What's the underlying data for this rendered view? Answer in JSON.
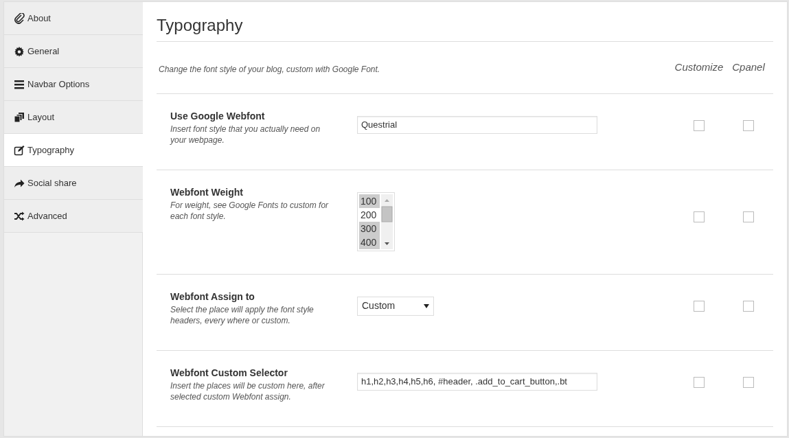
{
  "sidebar": {
    "items": [
      {
        "label": "About",
        "selected": false
      },
      {
        "label": "General",
        "selected": false
      },
      {
        "label": "Navbar Options",
        "selected": false
      },
      {
        "label": "Layout",
        "selected": false
      },
      {
        "label": "Typography",
        "selected": true
      },
      {
        "label": "Social share",
        "selected": false
      },
      {
        "label": "Advanced",
        "selected": false
      }
    ]
  },
  "page": {
    "title": "Typography",
    "description": "Change the font style of your blog, custom with Google Font.",
    "columns": [
      "Customize",
      "Cpanel"
    ]
  },
  "settings": [
    {
      "label": "Use Google Webfont",
      "help": "Insert font style that you actually need on your webpage.",
      "kind": "text",
      "value": "Questrial",
      "customize": false,
      "cpanel": false
    },
    {
      "label": "Webfont Weight",
      "help": "For weight, see Google Fonts to custom for each font style.",
      "kind": "listbox",
      "options": [
        {
          "label": "100",
          "selected": true
        },
        {
          "label": "200",
          "selected": false
        },
        {
          "label": "300",
          "selected": true
        },
        {
          "label": "400",
          "selected": true
        }
      ],
      "customize": false,
      "cpanel": false
    },
    {
      "label": "Webfont Assign to",
      "help": "Select the place will apply the font style headers, every where or custom.",
      "kind": "select",
      "value": "Custom",
      "customize": false,
      "cpanel": false
    },
    {
      "label": "Webfont Custom Selector",
      "help": "Insert the places will be custom here, after selected custom Webfont assign.",
      "kind": "text",
      "value": "h1,h2,h3,h4,h5,h6, #header, .add_to_cart_button,.bt",
      "customize": false,
      "cpanel": false
    }
  ]
}
